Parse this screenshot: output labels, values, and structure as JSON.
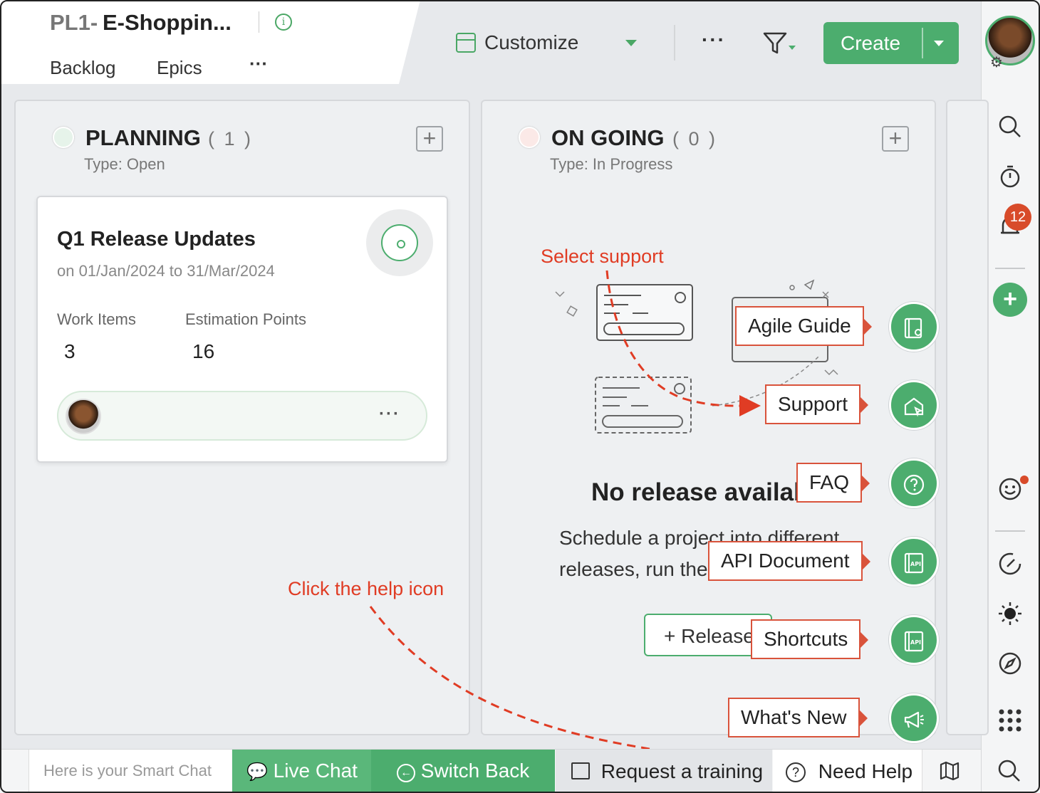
{
  "header": {
    "project_prefix": "PL1-",
    "project_name": "E-Shoppin...",
    "tabs": [
      "Backlog",
      "Epics"
    ],
    "more": "···"
  },
  "toolbar": {
    "customize": "Customize",
    "more": "···",
    "create": "Create"
  },
  "sidebar": {
    "notification_count": "12"
  },
  "columns": [
    {
      "title": "PLANNING",
      "count": "( 1 )",
      "type": "Type: Open",
      "dot_color": "#e6f3ea"
    },
    {
      "title": "ON GOING",
      "count": "( 0 )",
      "type": "Type: In Progress",
      "dot_color": "#fbe9e7"
    }
  ],
  "release_card": {
    "title": "Q1 Release Updates",
    "date_range": "on 01/Jan/2024 to 31/Mar/2024",
    "work_items_label": "Work Items",
    "work_items_value": "3",
    "estimation_label": "Estimation Points",
    "estimation_value": "16",
    "more": "···"
  },
  "empty_state": {
    "title": "No release availab",
    "desc_line1": "Schedule a project into different",
    "desc_line2": "releases, run the",
    "release_button": "+ Release"
  },
  "help_menu": [
    {
      "label": "Agile Guide",
      "icon": "guide-icon"
    },
    {
      "label": "Support",
      "icon": "support-icon"
    },
    {
      "label": "FAQ",
      "icon": "question-icon"
    },
    {
      "label": "API Document",
      "icon": "api-icon"
    },
    {
      "label": "Shortcuts",
      "icon": "api-icon"
    },
    {
      "label": "What's New",
      "icon": "megaphone-icon"
    }
  ],
  "annotations": {
    "select_support": "Select support",
    "click_help": "Click the help icon",
    "color": "#e03c24"
  },
  "bottom_bar": {
    "smart_chat_placeholder": "Here is your Smart Chat",
    "live_chat": "Live Chat",
    "switch_back": "Switch Back",
    "request_training": "Request a training",
    "need_help": "Need Help"
  },
  "colors": {
    "accent": "#4cad6e",
    "badge": "#d84b2a"
  }
}
